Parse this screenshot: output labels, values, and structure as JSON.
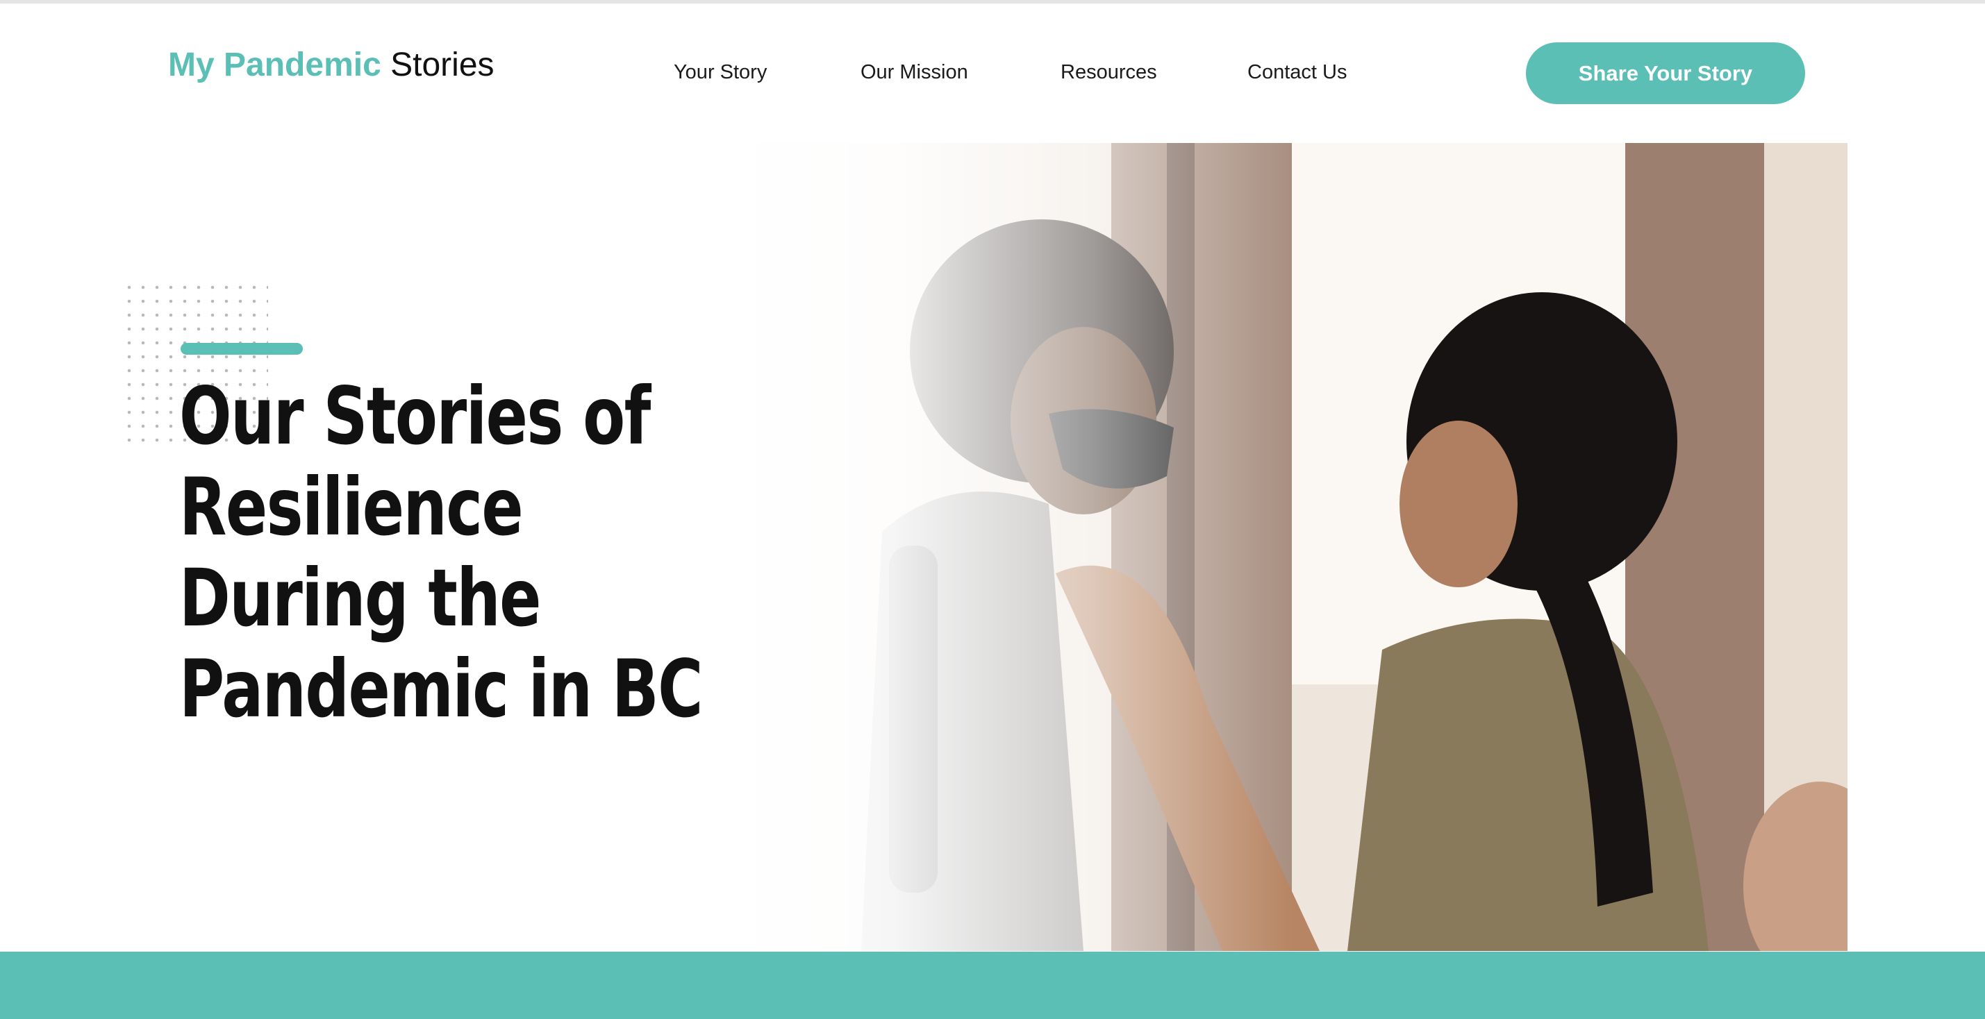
{
  "header": {
    "logo_accent": "My Pandemic",
    "logo_rest": "Stories",
    "nav": [
      "Your Story",
      "Our Mission",
      "Resources",
      "Contact Us"
    ],
    "cta_label": "Share Your Story"
  },
  "hero": {
    "title_lines": [
      "Our Stories of",
      "Resilience",
      "During the",
      "Pandemic in BC"
    ],
    "image_description_icon": "hero-photo"
  },
  "colors": {
    "accent": "#5bbfb5",
    "text": "#111111",
    "background": "#ffffff"
  }
}
